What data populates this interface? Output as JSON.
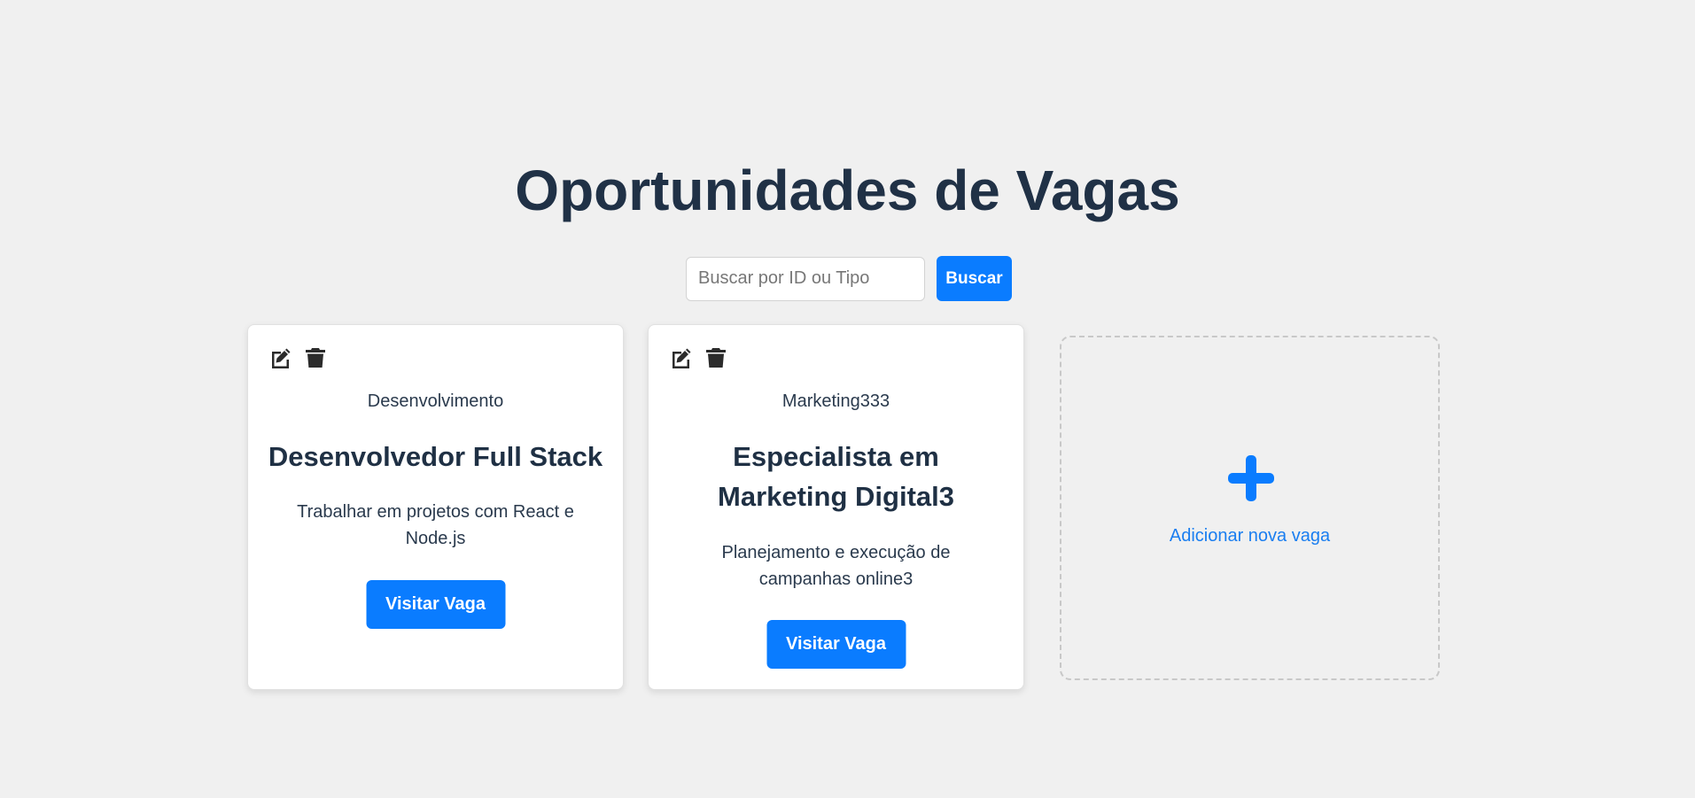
{
  "page": {
    "title": "Oportunidades de Vagas"
  },
  "search": {
    "placeholder": "Buscar por ID ou Tipo",
    "value": "",
    "button_label": "Buscar"
  },
  "jobs": [
    {
      "type": "Desenvolvimento",
      "title": "Desenvolvedor Full Stack",
      "description": "Trabalhar em projetos com React e Node.js",
      "button_label": "Visitar Vaga",
      "actions": [
        "edit-icon",
        "trash-icon"
      ]
    },
    {
      "type": "Marketing333",
      "title": "Especialista em Marketing Digital3",
      "description": "Planejamento e execução de campanhas online3",
      "button_label": "Visitar Vaga",
      "actions": [
        "edit-icon",
        "trash-icon"
      ]
    }
  ],
  "add_card": {
    "label": "Adicionar nova vaga",
    "icon": "plus-icon"
  },
  "colors": {
    "background": "#f0f0f0",
    "accent": "#0a7cff",
    "title": "#203146",
    "add_link": "#1a7ef0"
  }
}
